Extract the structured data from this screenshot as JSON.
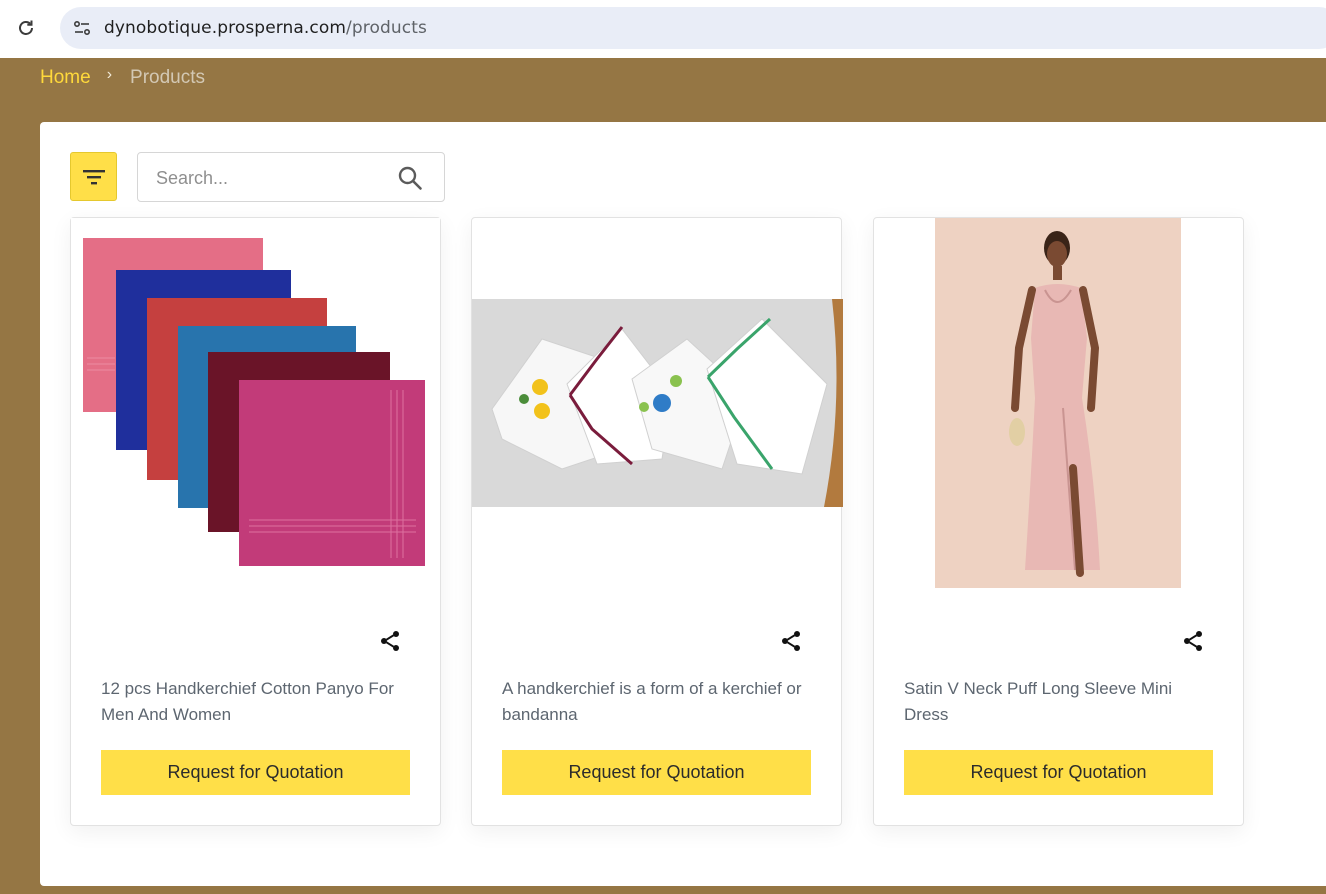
{
  "browser": {
    "url_host": "dynobotique.prosperna.com",
    "url_path": "/products"
  },
  "breadcrumb": {
    "home": "Home",
    "separator": "›",
    "current": "Products"
  },
  "toolbar": {
    "filter_icon": "filter-icon",
    "search_placeholder": "Search...",
    "search_icon": "search-icon"
  },
  "colors": {
    "page_background": "#957644",
    "accent_yellow": "#ffdf48",
    "breadcrumb_active": "#ffd93b"
  },
  "products": [
    {
      "title": "12 pcs Handkerchief Cotton Panyo For Men And Women",
      "button_label": "Request for Quotation",
      "share_icon": "share-icon",
      "image": "stack-of-colored-handkerchiefs"
    },
    {
      "title": "A handkerchief is a form of a kerchief or bandanna",
      "button_label": "Request for Quotation",
      "share_icon": "share-icon",
      "image": "embroidered-white-handkerchiefs"
    },
    {
      "title": "Satin V Neck Puff Long Sleeve Mini Dress",
      "button_label": "Request for Quotation",
      "share_icon": "share-icon",
      "image": "woman-in-pink-satin-dress"
    }
  ]
}
